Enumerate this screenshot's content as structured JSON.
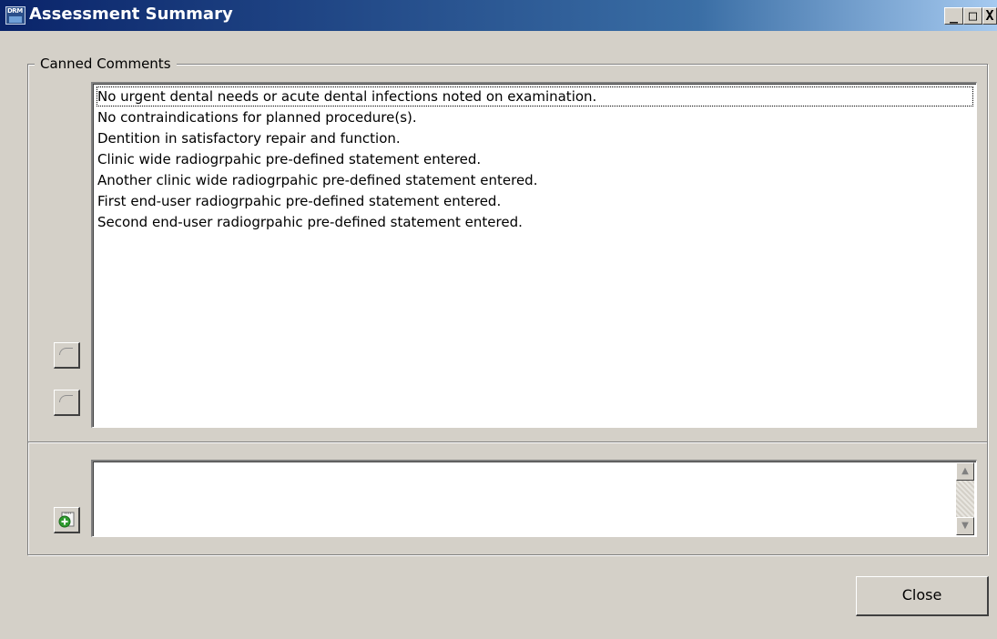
{
  "window": {
    "title": "Assessment Summary",
    "app_icon_text": "DRM",
    "controls": {
      "minimize": "_",
      "maximize": "□",
      "close": "X"
    }
  },
  "canned_comments": {
    "label": "Canned Comments",
    "items": [
      "No urgent dental needs or acute dental infections noted on examination.",
      "No contraindications for planned procedure(s).",
      "Dentition in satisfactory repair and function.",
      "Clinic wide radiogrpahic pre-defined statement entered.",
      "Another clinic wide radiogrpahic pre-defined statement entered.",
      "First end-user radiogrpahic pre-defined statement entered.",
      "Second end-user radiogrpahic pre-defined statement entered."
    ]
  },
  "comment_editor": {
    "value": ""
  },
  "icons": {
    "move_up": "move-up-icon",
    "move_down": "move-down-icon",
    "add": "add-comment-icon",
    "scroll_up": "scroll-up-icon",
    "scroll_down": "scroll-down-icon"
  },
  "footer": {
    "close_label": "Close"
  },
  "colors": {
    "titlebar_start": "#0a246a",
    "titlebar_end": "#a6caf0",
    "window_bg": "#d4d0c8",
    "add_icon_green": "#2e9b2e"
  }
}
